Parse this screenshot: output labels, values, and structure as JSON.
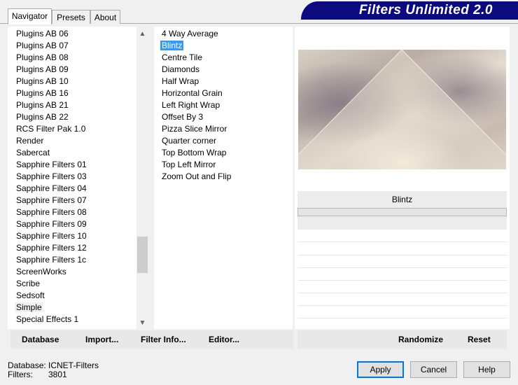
{
  "tabs": [
    "Navigator",
    "Presets",
    "About"
  ],
  "banner_title": "Filters Unlimited 2.0",
  "categories": [
    "Plugins AB 06",
    "Plugins AB 07",
    "Plugins AB 08",
    "Plugins AB 09",
    "Plugins AB 10",
    "Plugins AB 16",
    "Plugins AB 21",
    "Plugins AB 22",
    "RCS Filter Pak 1.0",
    "Render",
    "Sabercat",
    "Sapphire Filters 01",
    "Sapphire Filters 03",
    "Sapphire Filters 04",
    "Sapphire Filters 07",
    "Sapphire Filters 08",
    "Sapphire Filters 09",
    "Sapphire Filters 10",
    "Sapphire Filters 12",
    "Sapphire Filters 1c",
    "ScreenWorks",
    "Scribe",
    "Sedsoft",
    "Simple",
    "Special Effects 1"
  ],
  "filters": [
    "4 Way Average",
    "Blintz",
    "Centre Tile",
    "Diamonds",
    "Half Wrap",
    "Horizontal Grain",
    "Left Right Wrap",
    "Offset By 3",
    "Pizza Slice Mirror",
    "Quarter corner",
    "Top Bottom Wrap",
    "Top Left Mirror",
    "Zoom Out and Flip"
  ],
  "selected_filter_name": "Blintz",
  "left_buttons": {
    "database": "Database",
    "import": "Import...",
    "filter_info": "Filter Info...",
    "editor": "Editor..."
  },
  "right_buttons": {
    "randomize": "Randomize",
    "reset": "Reset"
  },
  "status": {
    "database_label": "Database:",
    "database_value": "ICNET-Filters",
    "filters_label": "Filters:",
    "filters_value": "3801"
  },
  "dialog_buttons": {
    "apply": "Apply",
    "cancel": "Cancel",
    "help": "Help"
  },
  "icons": {
    "scroll_up": "scroll-up-arrow-icon",
    "scroll_down": "scroll-down-arrow-icon"
  },
  "colors": {
    "banner": "#0b0a7e",
    "selection": "#3399ff"
  }
}
